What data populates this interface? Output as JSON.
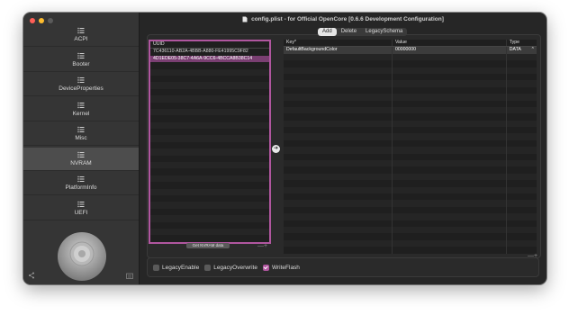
{
  "window": {
    "title": "config.plist - for Official OpenCore [0.6.6 Development Configuration]",
    "traffic_lights": {
      "close": "#ff5f57",
      "minimize": "#febc2e",
      "zoom": "#5a5a5a"
    }
  },
  "sidebar": {
    "items": [
      {
        "label": "ACPI",
        "icon": "list-icon"
      },
      {
        "label": "Booter",
        "icon": "list-icon"
      },
      {
        "label": "DeviceProperties",
        "icon": "list-icon"
      },
      {
        "label": "Kernel",
        "icon": "list-icon"
      },
      {
        "label": "Misc",
        "icon": "list-icon"
      },
      {
        "label": "NVRAM",
        "icon": "list-icon"
      },
      {
        "label": "PlatformInfo",
        "icon": "list-icon"
      },
      {
        "label": "UEFI",
        "icon": "list-icon"
      }
    ],
    "selected": "NVRAM",
    "bottom_left_icon": "share-icon",
    "bottom_right_icon": "export-icon"
  },
  "tabs": [
    {
      "label": "Add",
      "active": true
    },
    {
      "label": "Delete",
      "active": false
    },
    {
      "label": "LegacySchema",
      "active": false
    }
  ],
  "uuid_table": {
    "header": "UUID",
    "rows": [
      "7C436110-AB2A-4BBB-A880-FE41995C9F82",
      "4D1EDE05-38C7-4A6A-9CC6-4BCCA8B38C14"
    ],
    "selected_index": 1,
    "get_button_label": "Get NVRAM data",
    "plus_minus": "—+"
  },
  "kv_table": {
    "headers": {
      "key": "Key*",
      "value": "Value",
      "type": "Type"
    },
    "rows": [
      {
        "key": "DefaultBackgroundColor",
        "value": "00000000",
        "type": "DATA"
      }
    ],
    "selected_index": 0,
    "plus_minus": "—+"
  },
  "options": [
    {
      "label": "LegacyEnable",
      "checked": false
    },
    {
      "label": "LegacyOverwrite",
      "checked": false
    },
    {
      "label": "WriteFlash",
      "checked": true
    }
  ],
  "colors": {
    "accent": "#b0569f",
    "selected_row": "#7a3f72"
  }
}
